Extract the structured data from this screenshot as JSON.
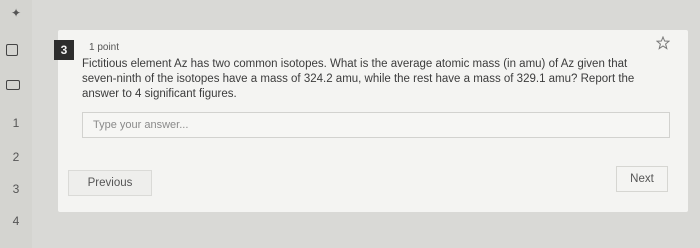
{
  "sidebar": {
    "items": [
      {
        "label": "1"
      },
      {
        "label": "2"
      },
      {
        "label": "3"
      },
      {
        "label": "4"
      }
    ]
  },
  "question": {
    "number": "3",
    "points": "1 point",
    "text": "Fictitious element Az has two common isotopes. What is the average atomic mass (in amu) of Az given that seven-ninth of the isotopes have a mass of 324.2 amu, while the rest have a mass of 329.1 amu? Report the answer to 4 significant figures.",
    "answer_placeholder": "Type your answer..."
  },
  "nav": {
    "previous_label": "Previous",
    "next_label": "Next"
  }
}
